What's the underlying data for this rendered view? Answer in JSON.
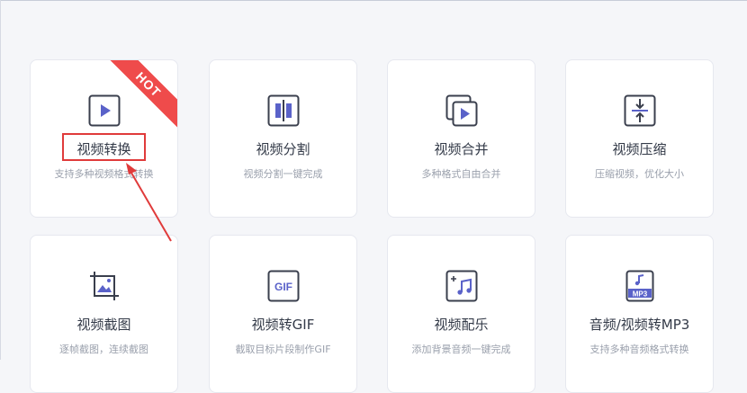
{
  "colors": {
    "accent": "#5a62c9",
    "hot": "#ef4b4b",
    "annotation": "#e03b3b"
  },
  "badge": {
    "hot": "HOT"
  },
  "cards": [
    {
      "title": "视频转换",
      "desc": "支持多种视频格式转换",
      "icon": "video-play-icon"
    },
    {
      "title": "视频分割",
      "desc": "视频分割一键完成",
      "icon": "split-icon"
    },
    {
      "title": "视频合并",
      "desc": "多种格式自由合并",
      "icon": "merge-icon"
    },
    {
      "title": "视频压缩",
      "desc": "压缩视频，优化大小",
      "icon": "compress-icon"
    },
    {
      "title": "视频截图",
      "desc": "逐帧截图，连续截图",
      "icon": "screenshot-icon"
    },
    {
      "title": "视频转GIF",
      "desc": "截取目标片段制作GIF",
      "icon": "gif-icon"
    },
    {
      "title": "视频配乐",
      "desc": "添加背景音频一键完成",
      "icon": "music-add-icon"
    },
    {
      "title": "音频/视频转MP3",
      "desc": "支持多种音频格式转换",
      "icon": "mp3-icon"
    }
  ]
}
